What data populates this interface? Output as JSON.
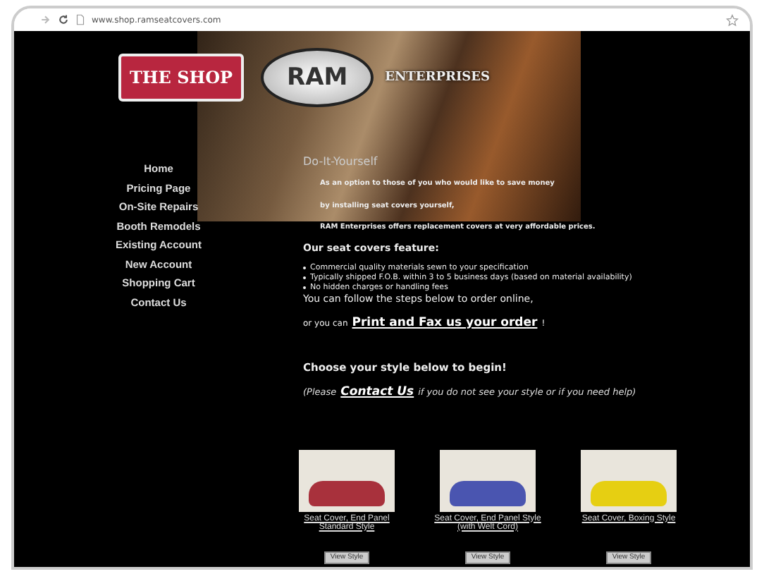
{
  "browser": {
    "address": "www.shop.ramseatcovers.com"
  },
  "header": {
    "shop_logo": "THE SHOP",
    "ram_logo": "RAM",
    "enterprises": "ENTERPRISES"
  },
  "nav": [
    "Home",
    "Pricing Page",
    "On-Site Repairs",
    "Booth Remodels",
    "Existing Account",
    "New Account",
    "Shopping Cart",
    "Contact Us"
  ],
  "content": {
    "title": "Do-It-Yourself",
    "intro": [
      "As an option to those of you who would like to save money",
      "by installing seat covers yourself,",
      "RAM Enterprises offers replacement covers at very affordable prices."
    ],
    "features_heading": "Our seat covers feature:",
    "features": [
      "Commercial quality materials sewn to your specification",
      "Typically shipped F.O.B. within 3 to 5 business days (based on material availability)",
      "No hidden charges or handling fees"
    ],
    "order_line": "You can follow the steps below to order online,",
    "fax_prefix": "or you can",
    "fax_link": "Print and Fax us your order",
    "fax_suffix": "!",
    "choose": "Choose your style below to begin!",
    "help_prefix": "(Please",
    "help_link": "Contact Us",
    "help_suffix": "if you do not see your style or if you need help)"
  },
  "products": [
    {
      "caption": "Seat Cover, End Panel Standard Style",
      "color": "#a8313c",
      "button": "View Style"
    },
    {
      "caption": "Seat Cover, End Panel Style (with Welt Cord)",
      "color": "#4a55b0",
      "button": "View Style"
    },
    {
      "caption": "Seat Cover, Boxing Style",
      "color": "#e6cf12",
      "button": "View Style"
    }
  ]
}
